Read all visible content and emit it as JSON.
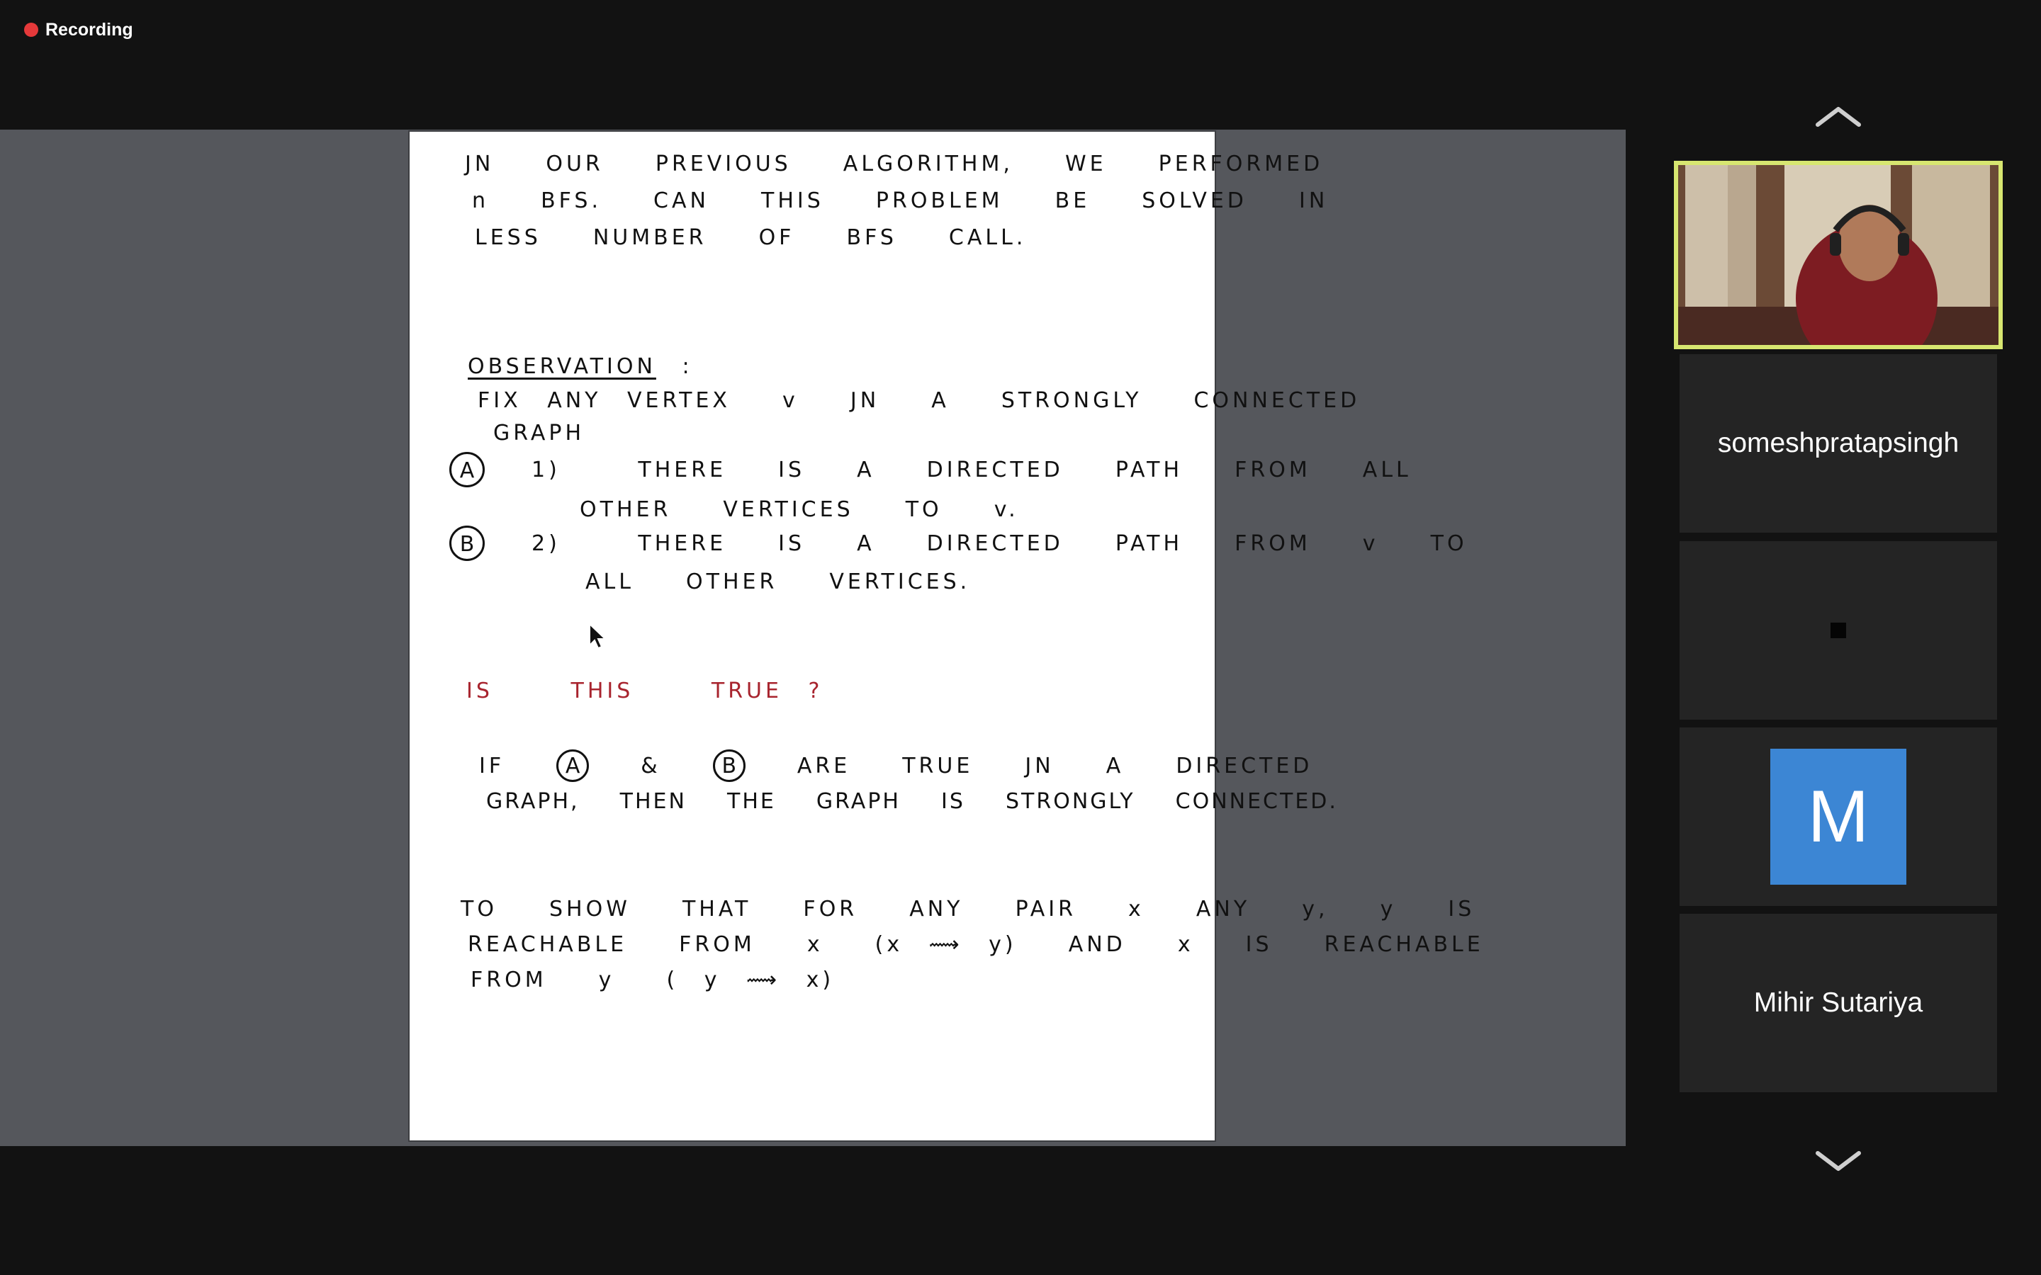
{
  "recording": {
    "label": "Recording",
    "color": "#e5393a"
  },
  "slide": {
    "lines": {
      "l1": "ЈN  OUR  PREVIOUS  ALGORITHM,  WE  PERFORMED",
      "l2": "n  BFS.  CAN  THIS  PROBLEM  BE  SOLVED  IN",
      "l3": "LESS  NUMBER  OF  BFS  CALL.",
      "obs_title": "OBSERVATION",
      "obs_colon": ":",
      "fix1": "FIX ANY VERTEX  v  ЈN  A  STRONGLY  CONNECTED",
      "fix2": "GRAPH",
      "circle_a": "A",
      "a1": "1)   THERE  IS  A  DIRECTED  PATH  FROM  ALL",
      "a2": "OTHER  VERTICES  TO  v.",
      "circle_b": "B",
      "b1": "2)   THERE  IS  A  DIRECTED  PATH  FROM  v  TO",
      "b2": "ALL  OTHER  VERTICES.",
      "question": "IS   THIS   TRUE ?",
      "if_prefix": "IF",
      "if_and": "&",
      "if_rest": "ARE  TRUE  ЈN  A  DIRECTED",
      "graph": "GRAPH,  THEN  THE  GRAPH  IS  STRONGLY  CONNECTED.",
      "show1": "TO  SHOW  THAT  FOR  ANY  PAIR  x  ANY  y,  y  IS",
      "show2": "REACHABLE  FROM  x  (x ⟿ y)  AND  x  IS  REACHABLE",
      "show3": "FROM  y  ( y ⟿ x)"
    }
  },
  "participants": [
    {
      "name": "someshpratapsingh"
    },
    {
      "name": ""
    },
    {
      "initial": "M",
      "avatar_color": "#3c86d4"
    },
    {
      "name": "Mihir Sutariya"
    }
  ],
  "active_speaker_border": "#d7e670"
}
